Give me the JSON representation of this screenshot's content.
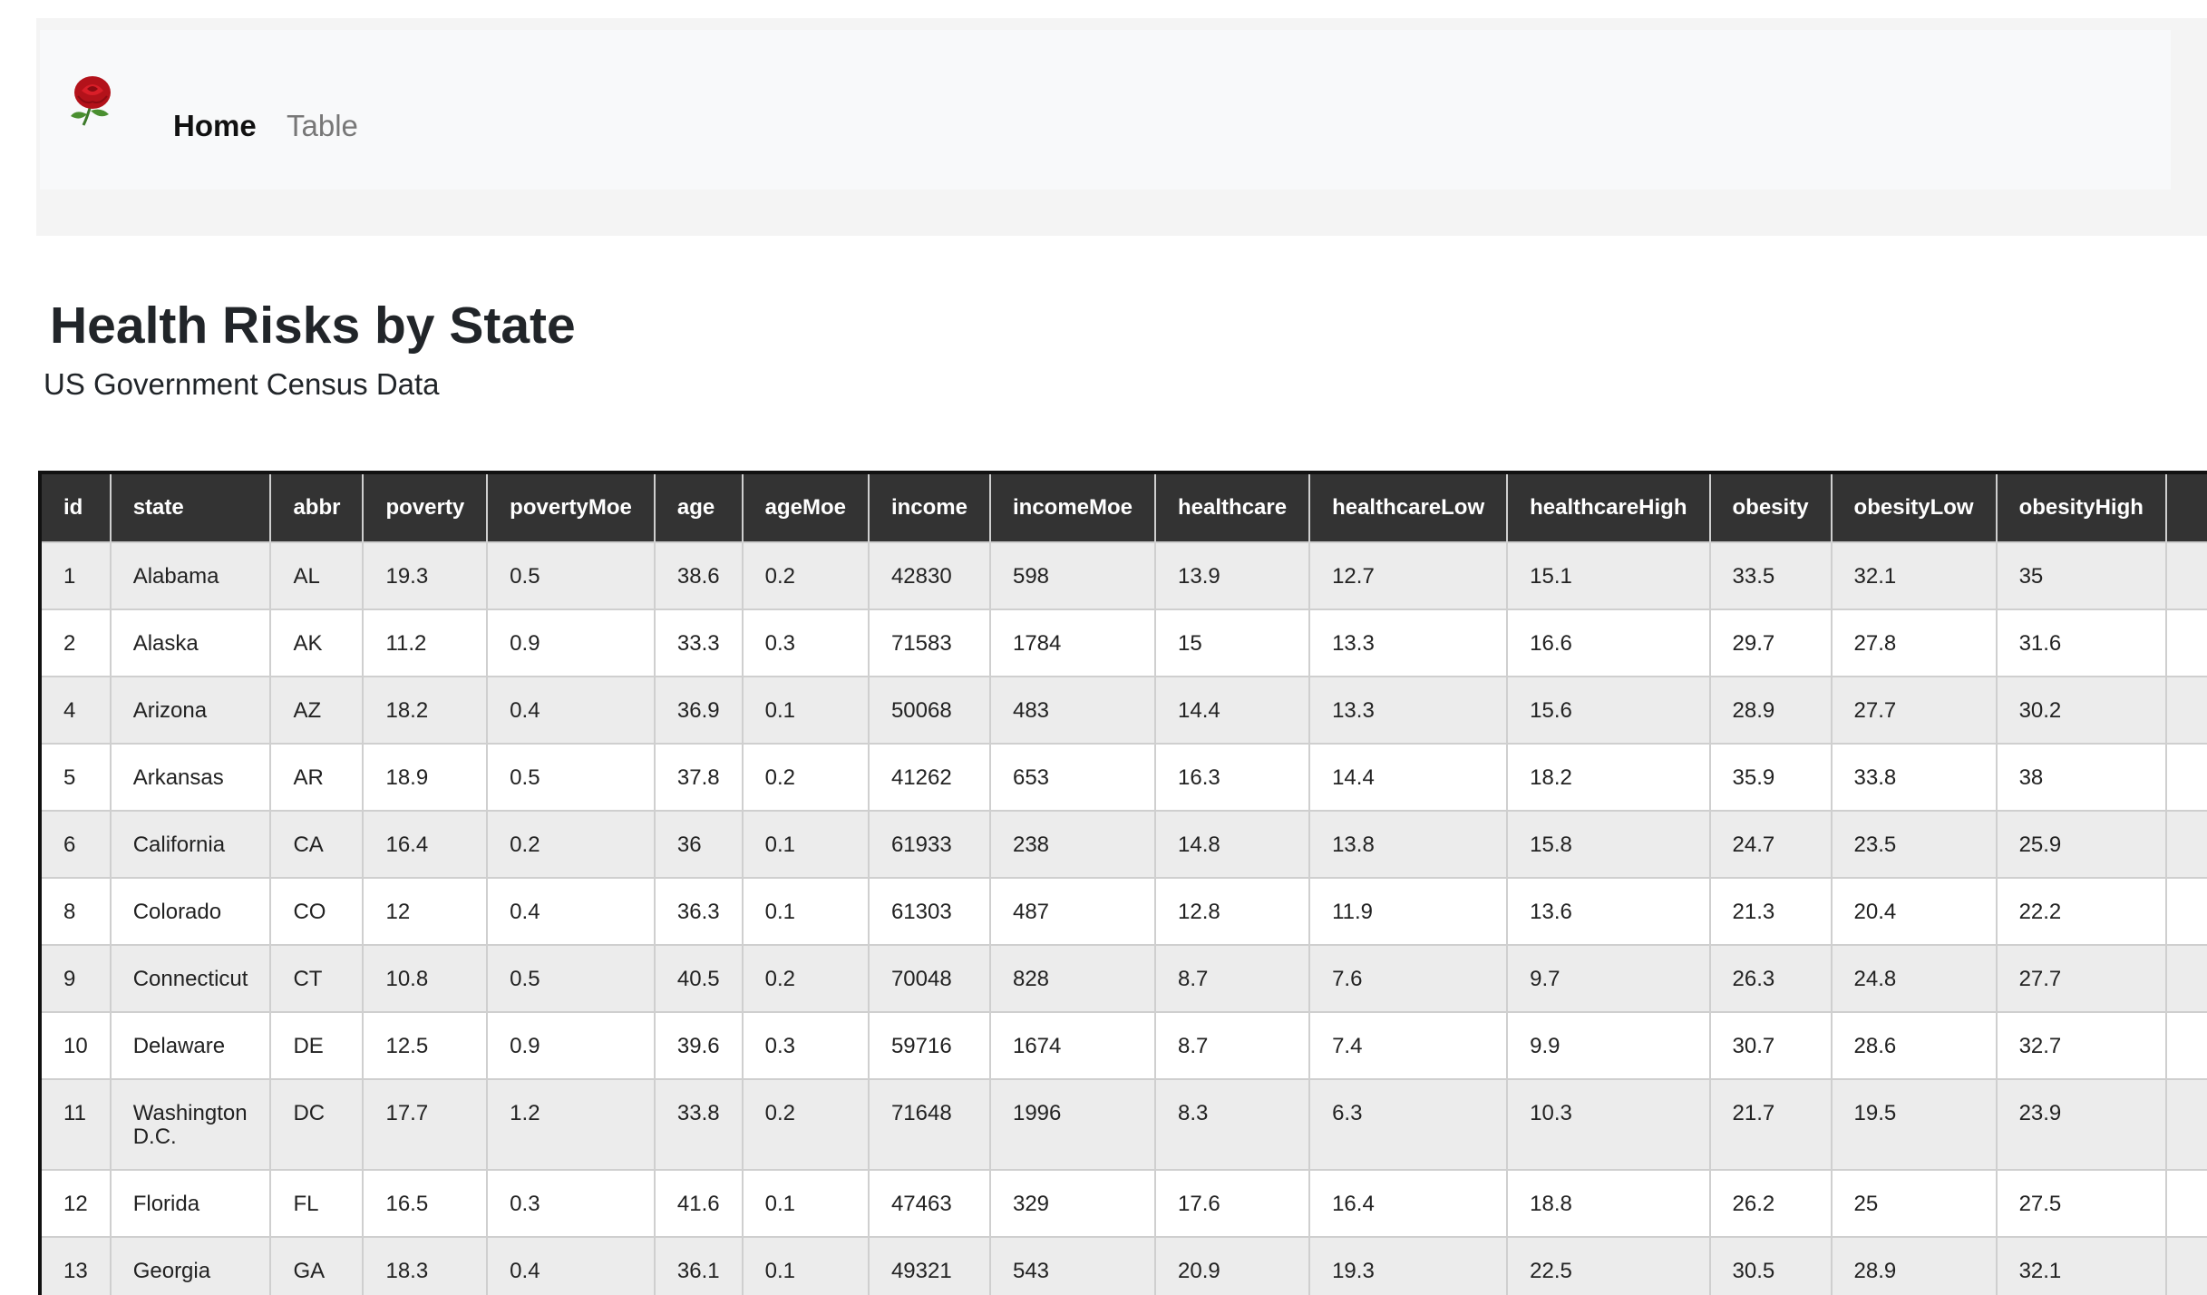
{
  "navbar": {
    "logo_icon": "rose-icon",
    "links": [
      "Home",
      "Table"
    ]
  },
  "page": {
    "title": "Health Risks by State",
    "subtitle": "US Government Census Data"
  },
  "table": {
    "columns": [
      "id",
      "state",
      "abbr",
      "poverty",
      "povertyMoe",
      "age",
      "ageMoe",
      "income",
      "incomeMoe",
      "healthcare",
      "healthcareLow",
      "healthcareHigh",
      "obesity",
      "obesityLow",
      "obesityHigh"
    ],
    "rows": [
      [
        "1",
        "Alabama",
        "AL",
        "19.3",
        "0.5",
        "38.6",
        "0.2",
        "42830",
        "598",
        "13.9",
        "12.7",
        "15.1",
        "33.5",
        "32.1",
        "35"
      ],
      [
        "2",
        "Alaska",
        "AK",
        "11.2",
        "0.9",
        "33.3",
        "0.3",
        "71583",
        "1784",
        "15",
        "13.3",
        "16.6",
        "29.7",
        "27.8",
        "31.6"
      ],
      [
        "4",
        "Arizona",
        "AZ",
        "18.2",
        "0.4",
        "36.9",
        "0.1",
        "50068",
        "483",
        "14.4",
        "13.3",
        "15.6",
        "28.9",
        "27.7",
        "30.2"
      ],
      [
        "5",
        "Arkansas",
        "AR",
        "18.9",
        "0.5",
        "37.8",
        "0.2",
        "41262",
        "653",
        "16.3",
        "14.4",
        "18.2",
        "35.9",
        "33.8",
        "38"
      ],
      [
        "6",
        "California",
        "CA",
        "16.4",
        "0.2",
        "36",
        "0.1",
        "61933",
        "238",
        "14.8",
        "13.8",
        "15.8",
        "24.7",
        "23.5",
        "25.9"
      ],
      [
        "8",
        "Colorado",
        "CO",
        "12",
        "0.4",
        "36.3",
        "0.1",
        "61303",
        "487",
        "12.8",
        "11.9",
        "13.6",
        "21.3",
        "20.4",
        "22.2"
      ],
      [
        "9",
        "Connecticut",
        "CT",
        "10.8",
        "0.5",
        "40.5",
        "0.2",
        "70048",
        "828",
        "8.7",
        "7.6",
        "9.7",
        "26.3",
        "24.8",
        "27.7"
      ],
      [
        "10",
        "Delaware",
        "DE",
        "12.5",
        "0.9",
        "39.6",
        "0.3",
        "59716",
        "1674",
        "8.7",
        "7.4",
        "9.9",
        "30.7",
        "28.6",
        "32.7"
      ],
      [
        "11",
        "Washington D.C.",
        "DC",
        "17.7",
        "1.2",
        "33.8",
        "0.2",
        "71648",
        "1996",
        "8.3",
        "6.3",
        "10.3",
        "21.7",
        "19.5",
        "23.9"
      ],
      [
        "12",
        "Florida",
        "FL",
        "16.5",
        "0.3",
        "41.6",
        "0.1",
        "47463",
        "329",
        "17.6",
        "16.4",
        "18.8",
        "26.2",
        "25",
        "27.5"
      ],
      [
        "13",
        "Georgia",
        "GA",
        "18.3",
        "0.4",
        "36.1",
        "0.1",
        "49321",
        "543",
        "20.9",
        "19.3",
        "22.5",
        "30.5",
        "28.9",
        "32.1"
      ]
    ]
  }
}
